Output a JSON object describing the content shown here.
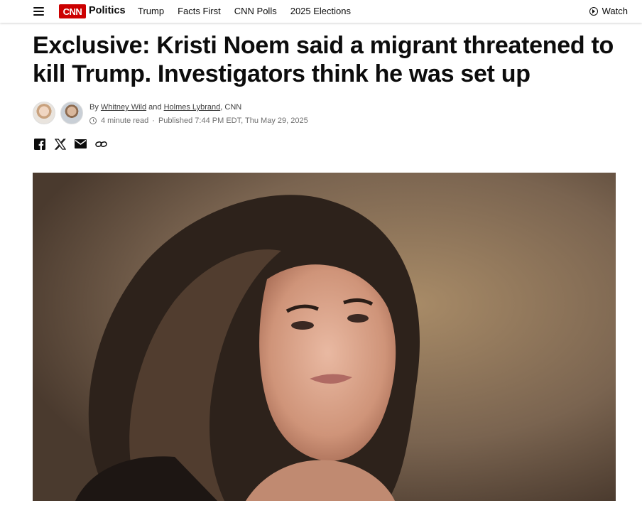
{
  "header": {
    "logo": "CNN",
    "section": "Politics",
    "nav": [
      "Trump",
      "Facts First",
      "CNN Polls",
      "2025 Elections"
    ],
    "watch_label": "Watch"
  },
  "article": {
    "headline": "Exclusive: Kristi Noem said a migrant threatened to kill Trump. Investigators think he was set up",
    "byline_prefix": "By",
    "author_1": "Whitney Wild",
    "byline_and": "and",
    "author_2": "Holmes Lybrand",
    "byline_suffix": ", CNN",
    "read_time": "4 minute read",
    "published": "Published 7:44 PM EDT, Thu May 29, 2025"
  },
  "share": {
    "icons": [
      "facebook-icon",
      "x-icon",
      "email-icon",
      "link-icon"
    ]
  },
  "colors": {
    "brand": "#cc0000",
    "text": "#0c0c0c",
    "meta": "#6e6e6e"
  }
}
